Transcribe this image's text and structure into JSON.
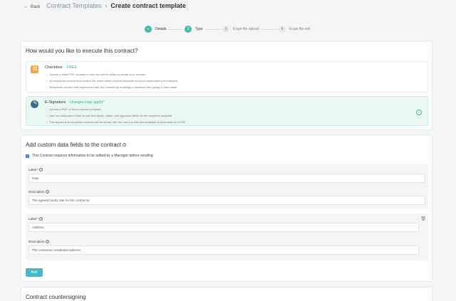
{
  "header": {
    "back_label": "Back",
    "breadcrumb_parent": "Contract Templates",
    "breadcrumb_sep": "›",
    "page_title": "Create contract template"
  },
  "steps": [
    {
      "number": "✓",
      "label": "Details",
      "state": "done"
    },
    {
      "number": "2",
      "label": "Type",
      "state": "active"
    },
    {
      "number": "3",
      "label": "Esign file upload",
      "state": "todo"
    },
    {
      "number": "4",
      "label": "Esign file edit",
      "state": "todo"
    }
  ],
  "execution": {
    "title": "How would you like to execute this contract?",
    "options": [
      {
        "name": "Checkbox",
        "tag": "FREE",
        "icon": "document-icon",
        "lines": [
          "Upload a static PDF contract or use our built-in editor to create your contract",
          "All recipients receive and confirm the exact same contract template text (not customised per recipient)",
          "Recipients confirm their agreement with the contract by enabling a checkbox and typing in their name"
        ],
        "selected": false
      },
      {
        "name": "E-Signature",
        "tag": "charges may apply*",
        "icon": "esign-icon",
        "lines": [
          "Upload a PDF or Word contract template",
          "Use our embedded editor to add text inputs, dates, and signature fields for the recipient complete",
          "The signed and completed contract will be stored with the user's profile and available to download as a PDF"
        ],
        "selected": true
      }
    ]
  },
  "custom_fields": {
    "title": "Add custom data fields to the contract",
    "checkbox_label": "This Contract requires information to be added by a Manager before sending",
    "checkbox_checked": true,
    "fields": [
      {
        "label_label": "Label *",
        "label_value": "Rate",
        "desc_label": "Description",
        "desc_value": "The agreed hourly rate for the contractor"
      },
      {
        "label_label": "Label *",
        "label_value": "Address",
        "desc_label": "Description",
        "desc_value": "The contractor residential address"
      }
    ],
    "add_button": "Add"
  },
  "countersigning": {
    "title": "Contract countersigning"
  },
  "colors": {
    "accent": "#4cb8a8",
    "selected_bg": "#e9f7f1",
    "free_tag": "#3bb37a"
  }
}
